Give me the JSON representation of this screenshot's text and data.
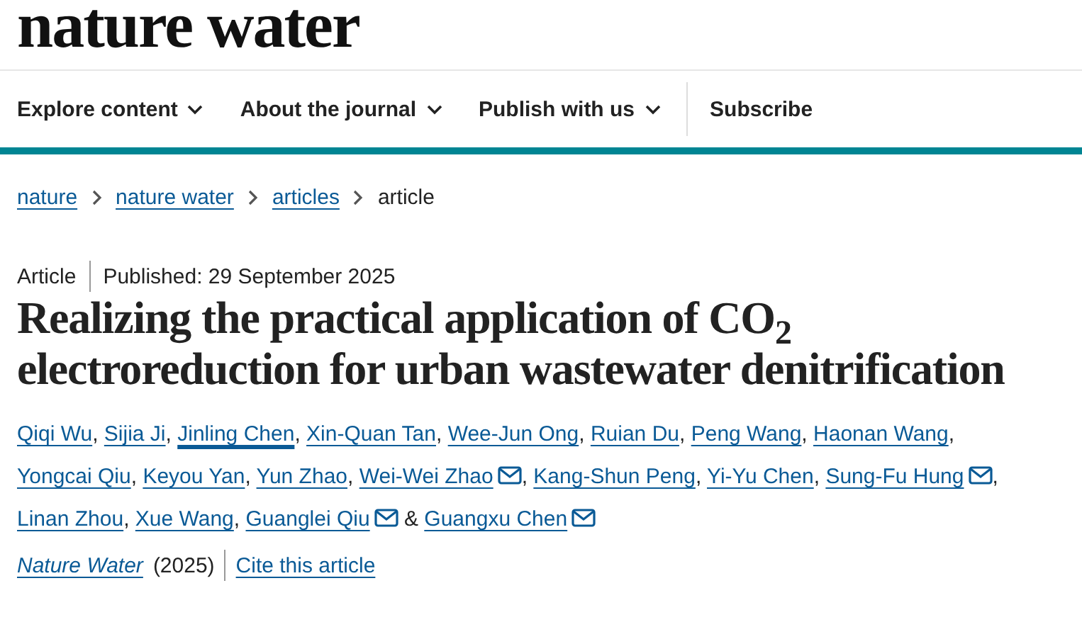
{
  "logo": "nature water",
  "nav": [
    {
      "label": "Explore content",
      "dropdown": true
    },
    {
      "label": "About the journal",
      "dropdown": true
    },
    {
      "label": "Publish with us",
      "dropdown": true
    },
    {
      "label": "Subscribe",
      "dropdown": false
    }
  ],
  "breadcrumbs": [
    "nature",
    "nature water",
    "articles",
    "article"
  ],
  "article_type": "Article",
  "published": "Published: 29 September 2025",
  "title": "Realizing the practical application of CO$_{2}$ electroreduction for urban wastewater denitrification",
  "authors": [
    {
      "name": "Qiqi Wu",
      "separator": ",",
      "email": false,
      "hovered": false
    },
    {
      "name": "Sijia Ji",
      "separator": ",",
      "email": false,
      "hovered": false
    },
    {
      "name": "Jinling Chen",
      "separator": ",",
      "email": false,
      "hovered": true
    },
    {
      "name": "Xin-Quan Tan",
      "separator": ",",
      "email": false,
      "hovered": false
    },
    {
      "name": "Wee-Jun Ong",
      "separator": ",",
      "email": false,
      "hovered": false
    },
    {
      "name": "Ruian Du",
      "separator": ",",
      "email": false,
      "hovered": false
    },
    {
      "name": "Peng Wang",
      "separator": ",",
      "email": false,
      "hovered": false
    },
    {
      "name": "Haonan Wang",
      "separator": ",",
      "email": false,
      "hovered": false
    },
    {
      "name": "Yongcai Qiu",
      "separator": ",",
      "email": false,
      "hovered": false
    },
    {
      "name": "Keyou Yan",
      "separator": ",",
      "email": false,
      "hovered": false
    },
    {
      "name": "Yun Zhao",
      "separator": ",",
      "email": false,
      "hovered": false
    },
    {
      "name": "Wei-Wei Zhao",
      "separator": ",",
      "email": true,
      "hovered": false
    },
    {
      "name": "Kang-Shun Peng",
      "separator": ",",
      "email": false,
      "hovered": false
    },
    {
      "name": "Yi-Yu Chen",
      "separator": ",",
      "email": false,
      "hovered": false
    },
    {
      "name": "Sung-Fu Hung",
      "separator": ",",
      "email": true,
      "hovered": false
    },
    {
      "name": "Linan Zhou",
      "separator": ",",
      "email": false,
      "hovered": false
    },
    {
      "name": "Xue Wang",
      "separator": ",",
      "email": false,
      "hovered": false
    },
    {
      "name": "Guanglei Qiu",
      "separator": "&",
      "email": true,
      "hovered": false
    },
    {
      "name": "Guangxu Chen",
      "email": true,
      "hovered": false
    }
  ],
  "journal": "Nature Water",
  "year": "(2025)",
  "cite": "Cite this article"
}
